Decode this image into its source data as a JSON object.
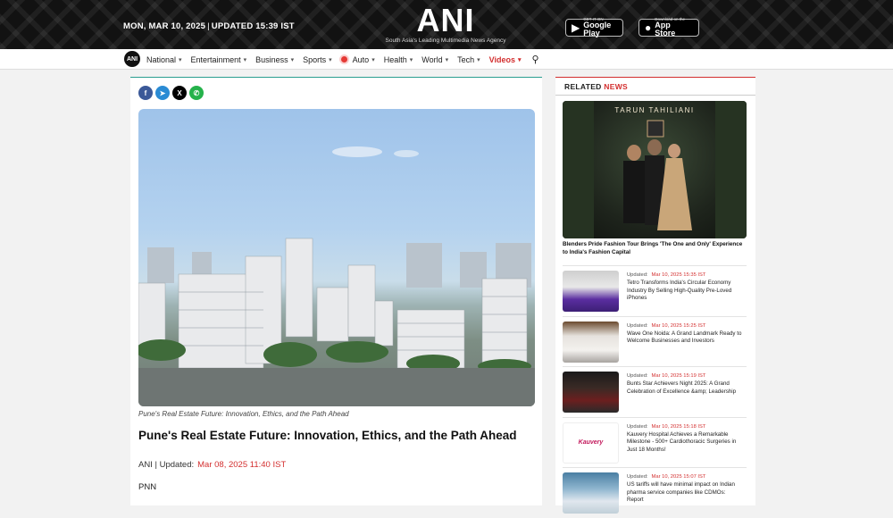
{
  "header": {
    "date": "MON, MAR 10, 2025",
    "updated": "UPDATED 15:39 IST",
    "logo": "ANI",
    "tagline": "South Asia's Leading Multimedia News Agency",
    "google_play": {
      "small": "GET IT ON",
      "big": "Google Play"
    },
    "app_store": {
      "small": "Download on the",
      "big": "App Store"
    }
  },
  "nav": {
    "logo_text": "ANI",
    "items": [
      {
        "label": "National"
      },
      {
        "label": "Entertainment"
      },
      {
        "label": "Business"
      },
      {
        "label": "Sports"
      },
      {
        "label": "Auto"
      },
      {
        "label": "Health"
      },
      {
        "label": "World"
      },
      {
        "label": "Tech"
      },
      {
        "label": "Videos"
      }
    ]
  },
  "article": {
    "caption": "Pune's Real Estate Future: Innovation, Ethics, and the Path Ahead",
    "title": "Pune's Real Estate Future: Innovation, Ethics, and the Path Ahead",
    "source": "ANI | Updated:",
    "date": "Mar 08, 2025 11:40 IST",
    "first_line": "PNN"
  },
  "sidebar": {
    "heading_a": "RELATED",
    "heading_b": "NEWS",
    "feature_brand": "TARUN TAHILIANI",
    "feature_title": "Blenders Pride Fashion Tour Brings 'The One and Only' Experience to India's Fashion Capital",
    "updated_label": "Updated:",
    "items": [
      {
        "date": "Mar 10, 2025 15:35 IST",
        "title": "Tetro Transforms India's Circular Economy Industry By Selling High-Quality Pre-Loved iPhones"
      },
      {
        "date": "Mar 10, 2025 15:25 IST",
        "title": "Wave One Noida: A Grand Landmark Ready to Welcome Businesses and Investors"
      },
      {
        "date": "Mar 10, 2025 15:19 IST",
        "title": "Bunts Star Achievers Night 2025: A Grand Celebration of Excellence &amp; Leadership"
      },
      {
        "date": "Mar 10, 2025 15:18 IST",
        "title": "Kauvery Hospital Achieves a Remarkable Milestone - 500+ Cardiothoracic Surgeries in Just 18 Months!",
        "logo": "Kauvery"
      },
      {
        "date": "Mar 10, 2025 15:07 IST",
        "title": "US tariffs will have minimal impact on Indian pharma service companies like CDMOs: Report"
      }
    ]
  },
  "colors": {
    "accent_red": "#d32f2f",
    "teal": "#2a9d8f",
    "topbar": "#121212"
  }
}
